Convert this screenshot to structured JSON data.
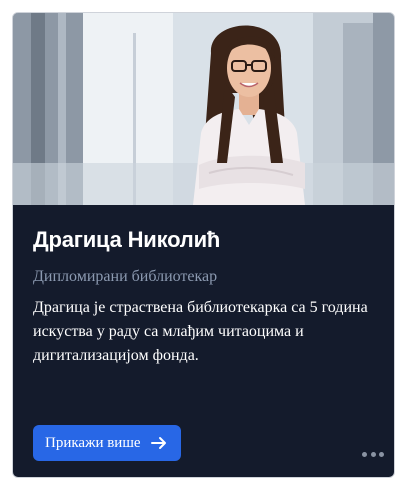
{
  "profile": {
    "name": "Драгица Николић",
    "title": "Дипломирани библиотекар",
    "bio": "Драгица је страствена библиотекарка са 5 година искуства у раду са млађим читаоцима и дигитализацијом фонда."
  },
  "actions": {
    "show_more_label": "Прикажи више",
    "show_more_icon": "arrow-right-icon",
    "menu_icon": "more-horizontal-icon"
  },
  "colors": {
    "card_bg": "#141b2c",
    "accent": "#2867e6",
    "muted_text": "#8c9ab1"
  }
}
